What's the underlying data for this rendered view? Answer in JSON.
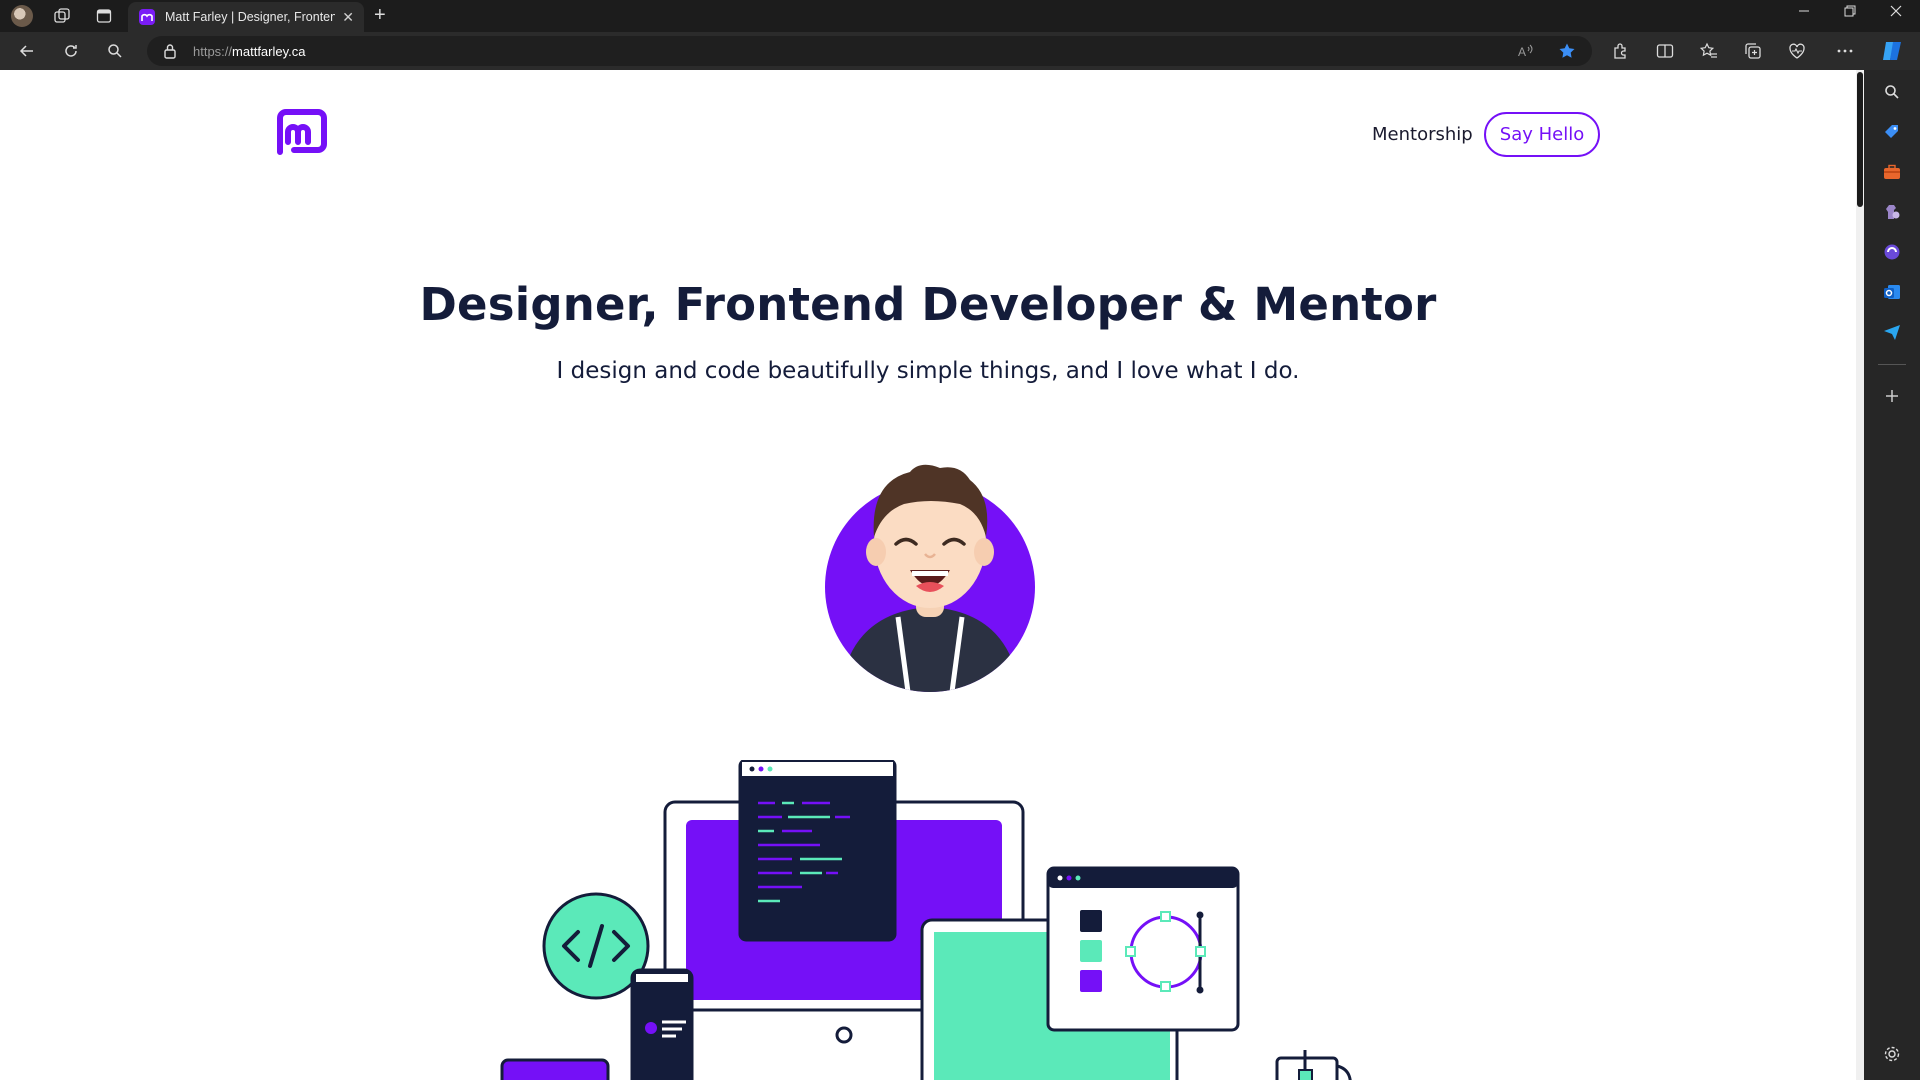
{
  "browser": {
    "tab_title": "Matt Farley | Designer, Frontend",
    "url_protocol": "https://",
    "url_host": "mattfarley.ca",
    "new_tab_symbol": "+",
    "tab_close_symbol": "✕"
  },
  "nav": {
    "mentorship_label": "Mentorship",
    "say_hello_label": "Say Hello"
  },
  "hero": {
    "title": "Designer, Frontend Developer & Mentor",
    "subtitle": "I design and code beautifully simple things, and I love what I do."
  },
  "colors": {
    "brand_purple": "#7510f7",
    "navy": "#141c3a",
    "mint": "#5be9b9"
  },
  "icons": {
    "toolbar": [
      "back-icon",
      "refresh-icon",
      "search-icon",
      "lock-icon",
      "read-aloud-icon",
      "favorite-star-icon",
      "extensions-icon",
      "split-screen-icon",
      "favorites-icon",
      "collections-icon",
      "browser-essentials-icon",
      "more-icon"
    ],
    "sidebar": [
      "search-icon",
      "shopping-tag-icon",
      "tools-briefcase-icon",
      "games-icon",
      "copilot-icon",
      "outlook-icon",
      "send-icon",
      "add-icon",
      "settings-icon"
    ]
  }
}
